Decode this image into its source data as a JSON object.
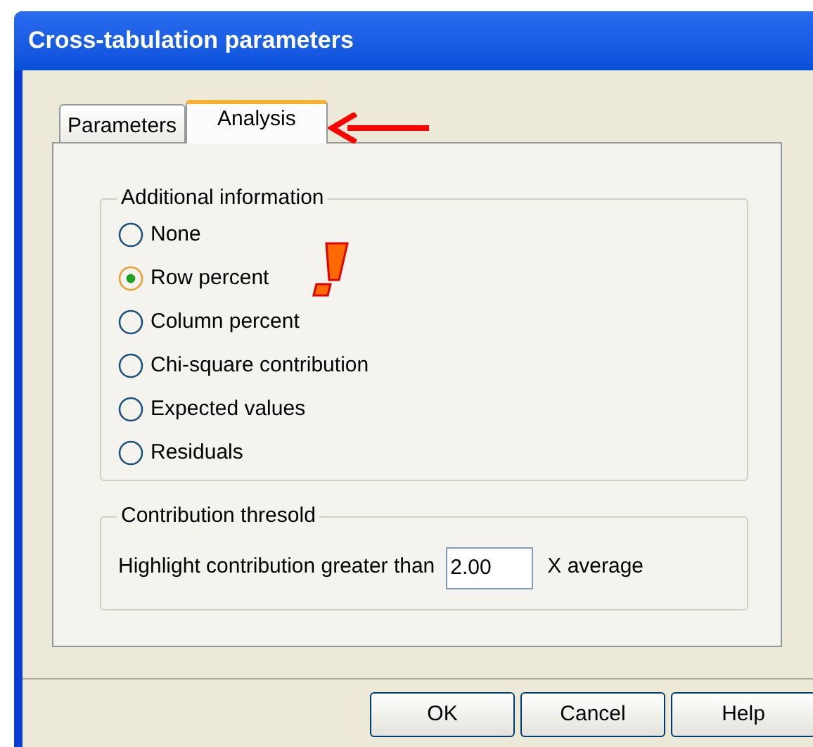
{
  "window": {
    "title": "Cross-tabulation parameters"
  },
  "tabs": [
    {
      "label": "Parameters",
      "selected": false
    },
    {
      "label": "Analysis",
      "selected": true
    }
  ],
  "additional_information": {
    "title": "Additional information",
    "options": [
      {
        "label": "None",
        "selected": false
      },
      {
        "label": "Row percent",
        "selected": true
      },
      {
        "label": "Column percent",
        "selected": false
      },
      {
        "label": "Chi-square contribution",
        "selected": false
      },
      {
        "label": "Expected values",
        "selected": false
      },
      {
        "label": "Residuals",
        "selected": false
      }
    ]
  },
  "contribution_threshold": {
    "title": "Contribution thresold",
    "label": "Highlight contribution greater than",
    "value": "2.00",
    "suffix": "X average"
  },
  "buttons": [
    "OK",
    "Cancel",
    "Help"
  ]
}
